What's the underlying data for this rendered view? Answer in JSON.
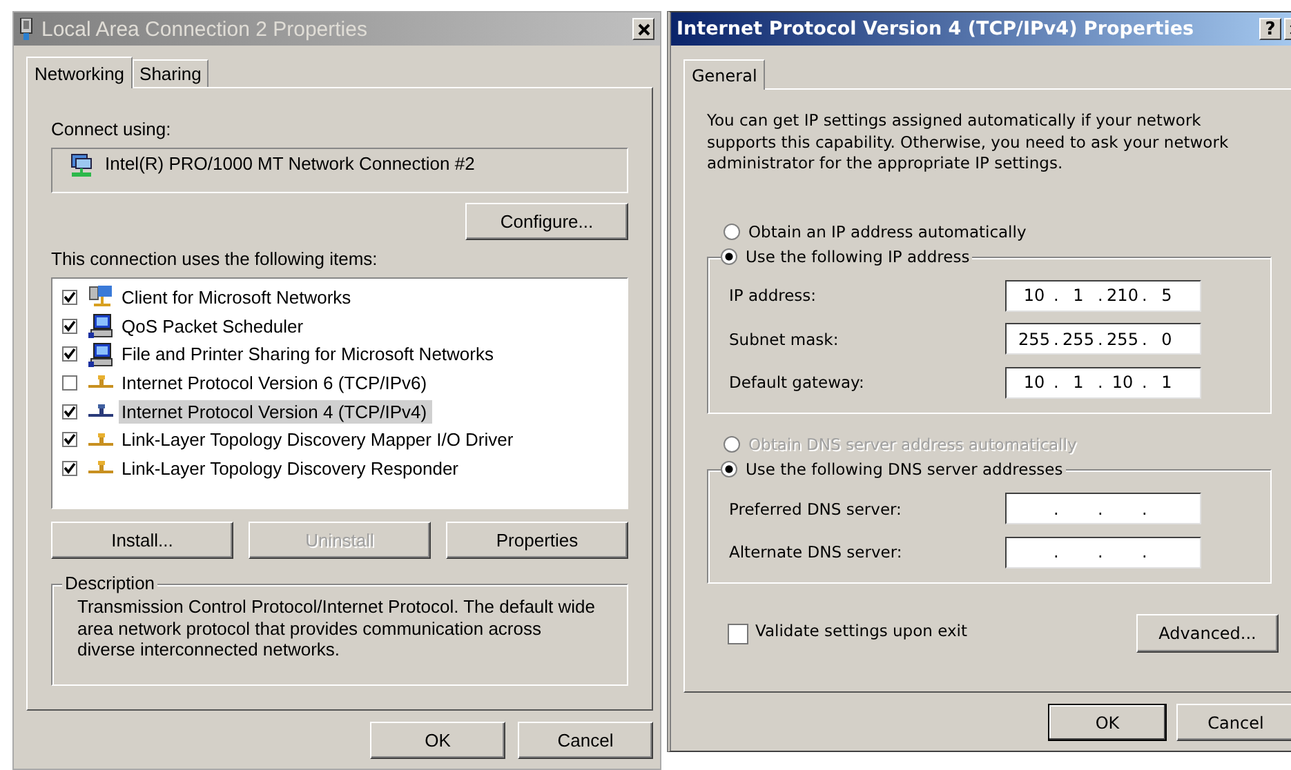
{
  "left_window": {
    "title": "Local Area Connection 2 Properties",
    "active": false,
    "tabs": [
      {
        "label": "Networking",
        "selected": true
      },
      {
        "label": "Sharing",
        "selected": false
      }
    ],
    "connect_label": "Connect using:",
    "adapter": "Intel(R) PRO/1000 MT Network Connection #2",
    "configure_button": "Configure...",
    "items_label": "This connection uses the following items:",
    "items": [
      {
        "label": "Client for Microsoft Networks",
        "kind": "client",
        "checked": true,
        "selected": false
      },
      {
        "label": "QoS Packet Scheduler",
        "kind": "service",
        "checked": true,
        "selected": false
      },
      {
        "label": "File and Printer Sharing for Microsoft Networks",
        "kind": "service",
        "checked": true,
        "selected": false
      },
      {
        "label": "Internet Protocol Version 6 (TCP/IPv6)",
        "kind": "protocol",
        "checked": false,
        "selected": false
      },
      {
        "label": "Internet Protocol Version 4 (TCP/IPv4)",
        "kind": "protocol",
        "checked": true,
        "selected": true
      },
      {
        "label": "Link-Layer Topology Discovery Mapper I/O Driver",
        "kind": "protocol",
        "checked": true,
        "selected": false
      },
      {
        "label": "Link-Layer Topology Discovery Responder",
        "kind": "protocol",
        "checked": true,
        "selected": false
      }
    ],
    "item_buttons": [
      {
        "label": "Install...",
        "disabled": false
      },
      {
        "label": "Uninstall",
        "disabled": true
      },
      {
        "label": "Properties",
        "disabled": false
      }
    ],
    "description": {
      "title": "Description",
      "text": "Transmission Control Protocol/Internet Protocol. The default wide area network protocol that provides communication across diverse interconnected networks."
    },
    "buttons": [
      {
        "label": "OK",
        "default": false
      },
      {
        "label": "Cancel",
        "default": false
      }
    ]
  },
  "right_window": {
    "title": "Internet Protocol Version 4 (TCP/IPv4) Properties",
    "active": true,
    "help_button": "?",
    "tabs": [
      {
        "label": "General",
        "selected": true
      }
    ],
    "intro": "You can get IP settings assigned automatically if your network supports this capability. Otherwise, you need to ask your network administrator for the appropriate IP settings.",
    "sections": [
      {
        "auto_option": {
          "label": "Obtain an IP address automatically",
          "selected": false,
          "disabled": false
        },
        "manual_option": {
          "label": "Use the following IP address",
          "selected": true,
          "disabled": false
        },
        "fields": [
          {
            "label": "IP address:",
            "octets": [
              "10",
              "1",
              "210",
              "5"
            ],
            "dots": [
              ".",
              ".",
              "."
            ]
          },
          {
            "label": "Subnet mask:",
            "octets": [
              "255",
              "255",
              "255",
              "0"
            ],
            "dots": [
              ".",
              ".",
              "."
            ]
          },
          {
            "label": "Default gateway:",
            "octets": [
              "10",
              "1",
              "10",
              "1"
            ],
            "dots": [
              ".",
              ".",
              "."
            ]
          }
        ]
      },
      {
        "auto_option": {
          "label": "Obtain DNS server address automatically",
          "selected": false,
          "disabled": true
        },
        "manual_option": {
          "label": "Use the following DNS server addresses",
          "selected": true,
          "disabled": false
        },
        "fields": [
          {
            "label": "Preferred DNS server:",
            "dots": [
              ".",
              ".",
              "."
            ]
          },
          {
            "label": "Alternate DNS server:",
            "dots": [
              ".",
              ".",
              "."
            ]
          }
        ]
      }
    ],
    "validate": {
      "label": "Validate settings upon exit",
      "checked": false
    },
    "advanced_button": "Advanced...",
    "buttons": [
      {
        "label": "OK",
        "default": true
      },
      {
        "label": "Cancel",
        "default": false
      }
    ]
  }
}
